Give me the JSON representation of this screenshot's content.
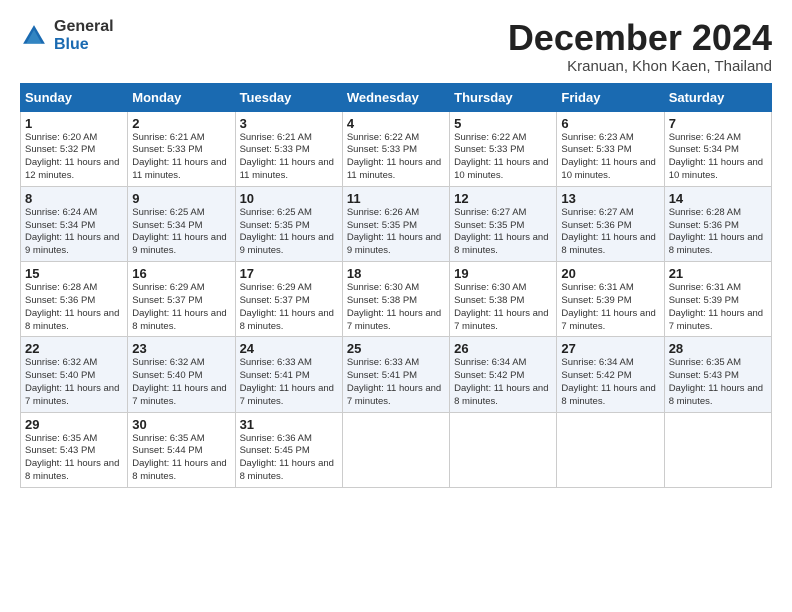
{
  "logo": {
    "general": "General",
    "blue": "Blue"
  },
  "title": "December 2024",
  "subtitle": "Kranuan, Khon Kaen, Thailand",
  "days_of_week": [
    "Sunday",
    "Monday",
    "Tuesday",
    "Wednesday",
    "Thursday",
    "Friday",
    "Saturday"
  ],
  "weeks": [
    [
      {
        "day": "1",
        "sunrise": "6:20 AM",
        "sunset": "5:32 PM",
        "daylight": "11 hours and 12 minutes."
      },
      {
        "day": "2",
        "sunrise": "6:21 AM",
        "sunset": "5:33 PM",
        "daylight": "11 hours and 11 minutes."
      },
      {
        "day": "3",
        "sunrise": "6:21 AM",
        "sunset": "5:33 PM",
        "daylight": "11 hours and 11 minutes."
      },
      {
        "day": "4",
        "sunrise": "6:22 AM",
        "sunset": "5:33 PM",
        "daylight": "11 hours and 11 minutes."
      },
      {
        "day": "5",
        "sunrise": "6:22 AM",
        "sunset": "5:33 PM",
        "daylight": "11 hours and 10 minutes."
      },
      {
        "day": "6",
        "sunrise": "6:23 AM",
        "sunset": "5:33 PM",
        "daylight": "11 hours and 10 minutes."
      },
      {
        "day": "7",
        "sunrise": "6:24 AM",
        "sunset": "5:34 PM",
        "daylight": "11 hours and 10 minutes."
      }
    ],
    [
      {
        "day": "8",
        "sunrise": "6:24 AM",
        "sunset": "5:34 PM",
        "daylight": "11 hours and 9 minutes."
      },
      {
        "day": "9",
        "sunrise": "6:25 AM",
        "sunset": "5:34 PM",
        "daylight": "11 hours and 9 minutes."
      },
      {
        "day": "10",
        "sunrise": "6:25 AM",
        "sunset": "5:35 PM",
        "daylight": "11 hours and 9 minutes."
      },
      {
        "day": "11",
        "sunrise": "6:26 AM",
        "sunset": "5:35 PM",
        "daylight": "11 hours and 9 minutes."
      },
      {
        "day": "12",
        "sunrise": "6:27 AM",
        "sunset": "5:35 PM",
        "daylight": "11 hours and 8 minutes."
      },
      {
        "day": "13",
        "sunrise": "6:27 AM",
        "sunset": "5:36 PM",
        "daylight": "11 hours and 8 minutes."
      },
      {
        "day": "14",
        "sunrise": "6:28 AM",
        "sunset": "5:36 PM",
        "daylight": "11 hours and 8 minutes."
      }
    ],
    [
      {
        "day": "15",
        "sunrise": "6:28 AM",
        "sunset": "5:36 PM",
        "daylight": "11 hours and 8 minutes."
      },
      {
        "day": "16",
        "sunrise": "6:29 AM",
        "sunset": "5:37 PM",
        "daylight": "11 hours and 8 minutes."
      },
      {
        "day": "17",
        "sunrise": "6:29 AM",
        "sunset": "5:37 PM",
        "daylight": "11 hours and 8 minutes."
      },
      {
        "day": "18",
        "sunrise": "6:30 AM",
        "sunset": "5:38 PM",
        "daylight": "11 hours and 7 minutes."
      },
      {
        "day": "19",
        "sunrise": "6:30 AM",
        "sunset": "5:38 PM",
        "daylight": "11 hours and 7 minutes."
      },
      {
        "day": "20",
        "sunrise": "6:31 AM",
        "sunset": "5:39 PM",
        "daylight": "11 hours and 7 minutes."
      },
      {
        "day": "21",
        "sunrise": "6:31 AM",
        "sunset": "5:39 PM",
        "daylight": "11 hours and 7 minutes."
      }
    ],
    [
      {
        "day": "22",
        "sunrise": "6:32 AM",
        "sunset": "5:40 PM",
        "daylight": "11 hours and 7 minutes."
      },
      {
        "day": "23",
        "sunrise": "6:32 AM",
        "sunset": "5:40 PM",
        "daylight": "11 hours and 7 minutes."
      },
      {
        "day": "24",
        "sunrise": "6:33 AM",
        "sunset": "5:41 PM",
        "daylight": "11 hours and 7 minutes."
      },
      {
        "day": "25",
        "sunrise": "6:33 AM",
        "sunset": "5:41 PM",
        "daylight": "11 hours and 7 minutes."
      },
      {
        "day": "26",
        "sunrise": "6:34 AM",
        "sunset": "5:42 PM",
        "daylight": "11 hours and 8 minutes."
      },
      {
        "day": "27",
        "sunrise": "6:34 AM",
        "sunset": "5:42 PM",
        "daylight": "11 hours and 8 minutes."
      },
      {
        "day": "28",
        "sunrise": "6:35 AM",
        "sunset": "5:43 PM",
        "daylight": "11 hours and 8 minutes."
      }
    ],
    [
      {
        "day": "29",
        "sunrise": "6:35 AM",
        "sunset": "5:43 PM",
        "daylight": "11 hours and 8 minutes."
      },
      {
        "day": "30",
        "sunrise": "6:35 AM",
        "sunset": "5:44 PM",
        "daylight": "11 hours and 8 minutes."
      },
      {
        "day": "31",
        "sunrise": "6:36 AM",
        "sunset": "5:45 PM",
        "daylight": "11 hours and 8 minutes."
      },
      null,
      null,
      null,
      null
    ]
  ],
  "labels": {
    "sunrise": "Sunrise:",
    "sunset": "Sunset:",
    "daylight": "Daylight:"
  }
}
